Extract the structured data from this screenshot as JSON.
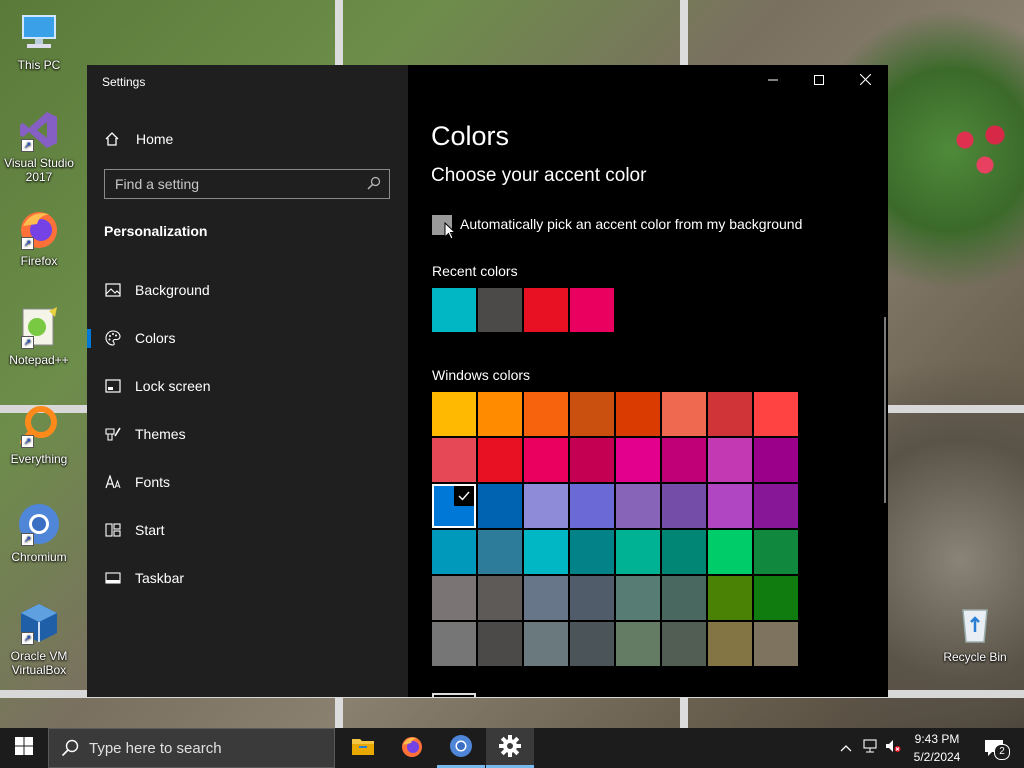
{
  "desktop": {
    "icons": [
      {
        "label": "This PC",
        "icon": "computer-icon"
      },
      {
        "label": "Visual Studio 2017",
        "icon": "visual-studio-icon"
      },
      {
        "label": "Firefox",
        "icon": "firefox-icon"
      },
      {
        "label": "Notepad++",
        "icon": "notepad-plus-plus-icon"
      },
      {
        "label": "Everything",
        "icon": "everything-search-icon"
      },
      {
        "label": "Chromium",
        "icon": "chromium-icon"
      },
      {
        "label": "Oracle VM VirtualBox",
        "icon": "virtualbox-icon"
      },
      {
        "label": "Recycle Bin",
        "icon": "recycle-bin-icon"
      }
    ]
  },
  "window": {
    "title": "Settings",
    "controls": {
      "minimize": "minimize-icon",
      "maximize": "maximize-icon",
      "close": "close-icon"
    }
  },
  "sidebar": {
    "home_label": "Home",
    "search_placeholder": "Find a setting",
    "section_title": "Personalization",
    "items": [
      {
        "label": "Background",
        "icon": "picture-icon",
        "active": false
      },
      {
        "label": "Colors",
        "icon": "palette-icon",
        "active": true
      },
      {
        "label": "Lock screen",
        "icon": "lock-screen-icon",
        "active": false
      },
      {
        "label": "Themes",
        "icon": "paint-brush-icon",
        "active": false
      },
      {
        "label": "Fonts",
        "icon": "fonts-icon",
        "active": false
      },
      {
        "label": "Start",
        "icon": "start-layout-icon",
        "active": false
      },
      {
        "label": "Taskbar",
        "icon": "taskbar-icon",
        "active": false
      }
    ]
  },
  "main": {
    "title": "Colors",
    "subtitle": "Choose your accent color",
    "auto_pick_label": "Automatically pick an accent color from my background",
    "auto_pick_checked": false,
    "recent_label": "Recent colors",
    "recent_colors": [
      "#00b7c3",
      "#4c4a48",
      "#e81123",
      "#ea005e"
    ],
    "windows_label": "Windows colors",
    "windows_colors": [
      [
        "#ffb900",
        "#ff8c00",
        "#f7630c",
        "#ca5010",
        "#da3b01",
        "#ef6950",
        "#d13438",
        "#ff4343"
      ],
      [
        "#e74856",
        "#e81123",
        "#ea005e",
        "#c30052",
        "#e3008c",
        "#bf0077",
        "#c239b3",
        "#9a0089"
      ],
      [
        "#0078d7",
        "#0063b1",
        "#8e8cd8",
        "#6b69d6",
        "#8764b8",
        "#744da9",
        "#b146c2",
        "#881798"
      ],
      [
        "#0099bc",
        "#2d7d9a",
        "#00b7c3",
        "#038387",
        "#00b294",
        "#018574",
        "#00cc6a",
        "#10893e"
      ],
      [
        "#7a7574",
        "#5d5a58",
        "#68768a",
        "#515c6b",
        "#567c73",
        "#486860",
        "#498205",
        "#107c10"
      ],
      [
        "#767676",
        "#4c4a48",
        "#69797e",
        "#4a5459",
        "#647c64",
        "#525e54",
        "#847545",
        "#7e735f"
      ]
    ],
    "selected_color": "#0078d7",
    "accent_color": "#0078d7"
  },
  "taskbar": {
    "search_placeholder": "Type here to search",
    "apps": [
      {
        "name": "file-explorer-icon",
        "open": false,
        "active": false
      },
      {
        "name": "firefox-icon",
        "open": false,
        "active": false
      },
      {
        "name": "chromium-icon",
        "open": true,
        "active": false
      },
      {
        "name": "settings-gear-icon",
        "open": true,
        "active": true
      }
    ],
    "time": "9:43 PM",
    "date": "5/2/2024",
    "notification_count": "2"
  }
}
